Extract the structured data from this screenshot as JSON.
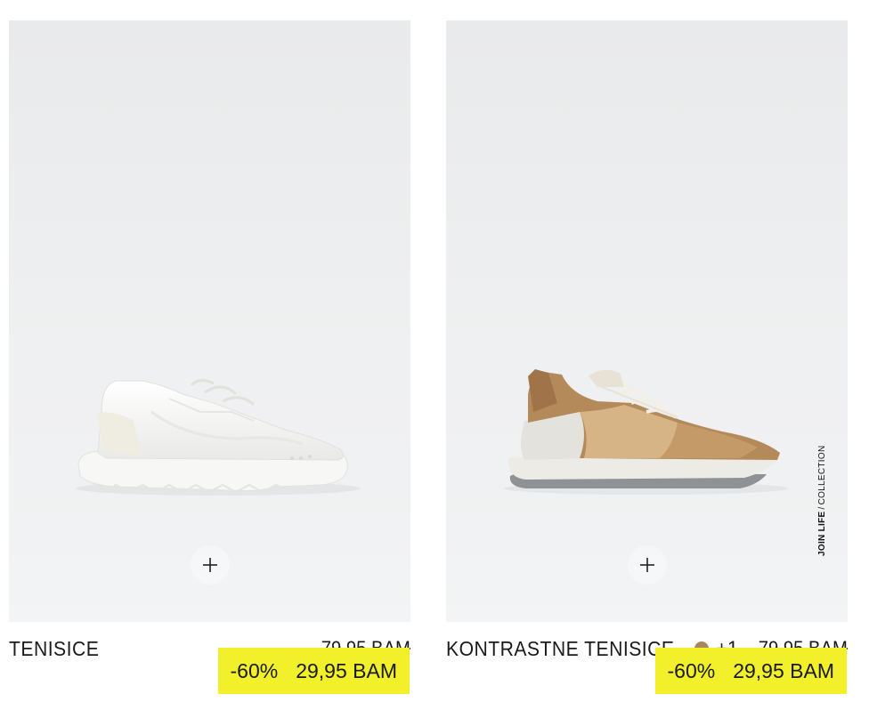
{
  "products": [
    {
      "name": "TENISICE",
      "original_price": "79,95 BAM",
      "discount": "-60%",
      "sale_price": "29,95 BAM",
      "add_icon": "plus-icon",
      "image": "white-sneaker-image"
    },
    {
      "name": "KONTRASTNE TENISICE",
      "original_price": "79,95 BAM",
      "discount": "-60%",
      "sale_price": "29,95 BAM",
      "color_swatch": "#a8855b",
      "more_colors": "+1",
      "add_icon": "plus-icon",
      "image": "brown-sneaker-image",
      "tag_bold": "JOIN LIFE",
      "tag_sep": "/",
      "tag_rest": "COLLECTION"
    }
  ],
  "colors": {
    "sale_highlight": "#f2f02a",
    "swatch_brown": "#a8855b"
  }
}
